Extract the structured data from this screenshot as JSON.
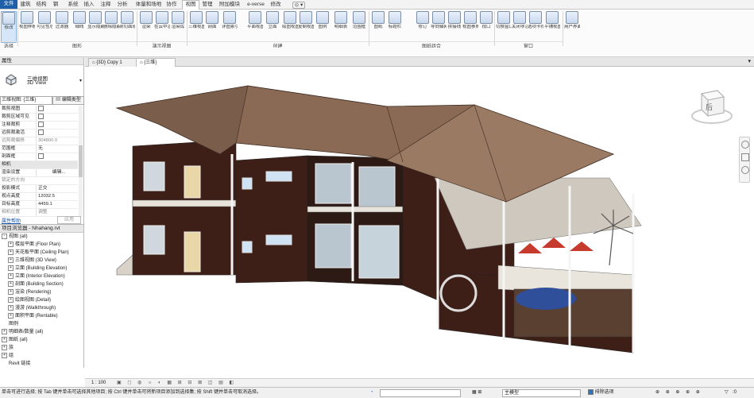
{
  "tabs": [
    "文件",
    "建筑",
    "结构",
    "钢",
    "系统",
    "插入",
    "注释",
    "分析",
    "体量和场地",
    "协作",
    "视图",
    "管理",
    "附加模块",
    "e-verse",
    "修改"
  ],
  "ribbon": {
    "buttons": [
      "修改",
      "视图样板",
      "可见性/图形",
      "过滤器",
      "细线",
      "显示隐藏线",
      "删除隐藏线",
      "剖切面轮廓",
      "渲染",
      "在云中渲染",
      "渲染库",
      "三维视图",
      "剖面",
      "详图索引",
      "平面视图",
      "立面",
      "绘图视图",
      "复制视图",
      "图例",
      "明细表",
      "范围框",
      "图纸",
      "标题栏",
      "修订",
      "导向轴网",
      "拼接线",
      "视图参照",
      "视口",
      "切换窗口",
      "关闭非活动",
      "选项卡视图",
      "平铺视图",
      "用户界面"
    ],
    "panels": [
      "选择",
      "图形",
      "演示视图",
      "创建",
      "图纸组合",
      "窗口"
    ]
  },
  "properties": {
    "title": "属性",
    "type_main": "三维视图",
    "type_sub": "3D View",
    "selector": "三维视图: {三维}",
    "edit_type": "编辑类型",
    "rows": [
      {
        "k": "裁剪视图",
        "v": ""
      },
      {
        "k": "裁剪区域可见",
        "v": ""
      },
      {
        "k": "注释裁剪",
        "v": ""
      },
      {
        "k": "远剪裁激活",
        "v": ""
      },
      {
        "k": "远剪裁偏移",
        "v": "304800.0"
      },
      {
        "k": "范围框",
        "v": "无"
      },
      {
        "k": "剖面框",
        "v": ""
      },
      {
        "k": "相机",
        "v": ""
      },
      {
        "k": "渲染设置",
        "v": "编辑..."
      },
      {
        "k": "锁定的方向",
        "v": ""
      },
      {
        "k": "投影模式",
        "v": "正交"
      },
      {
        "k": "视点高度",
        "v": "12032.5"
      },
      {
        "k": "目标高度",
        "v": "4459.1"
      },
      {
        "k": "相机位置",
        "v": "调整"
      }
    ],
    "help": "属性帮助",
    "apply": "应用"
  },
  "browser": {
    "title": "项目浏览器 - Nhahang.rvt",
    "items": [
      {
        "label": "视图 (all)",
        "level": 0,
        "sign": "-"
      },
      {
        "label": "楼层平面 (Floor Plan)",
        "level": 1,
        "sign": "+"
      },
      {
        "label": "天花板平面 (Ceiling Plan)",
        "level": 1,
        "sign": "+"
      },
      {
        "label": "三维视图 (3D View)",
        "level": 1,
        "sign": "+"
      },
      {
        "label": "立面 (Building Elevation)",
        "level": 1,
        "sign": "+"
      },
      {
        "label": "立面 (Interior Elevation)",
        "level": 1,
        "sign": "+"
      },
      {
        "label": "剖面 (Building Section)",
        "level": 1,
        "sign": "+"
      },
      {
        "label": "渲染 (Rendering)",
        "level": 1,
        "sign": "+"
      },
      {
        "label": "绘图视图 (Detail)",
        "level": 1,
        "sign": "+"
      },
      {
        "label": "漫游 (Walkthrough)",
        "level": 1,
        "sign": "+"
      },
      {
        "label": "面积平面 (Rentable)",
        "level": 1,
        "sign": "+"
      },
      {
        "label": "图例",
        "level": 0,
        "sign": ""
      },
      {
        "label": "明细表/数量 (all)",
        "level": 0,
        "sign": "+"
      },
      {
        "label": "图纸 (all)",
        "level": 0,
        "sign": "+"
      },
      {
        "label": "族",
        "level": 0,
        "sign": "+"
      },
      {
        "label": "组",
        "level": 0,
        "sign": "+"
      },
      {
        "label": "Revit 链接",
        "level": 0,
        "sign": ""
      }
    ]
  },
  "view_tabs": [
    "{3D} Copy 1",
    "{三维}"
  ],
  "viewcube_label": "后",
  "viewbar": {
    "scale": "1 : 100"
  },
  "status": {
    "hint": "单击可进行选择; 按 Tab 键并单击可选择其他项目; 按 Ctrl 键并单击可将新项目添加到选择集; 按 Shift 键并单击可取消选择。",
    "model": "主模型",
    "exclude": "排除选项",
    "count": ":0"
  },
  "colors": {
    "roof": "#8a6a55",
    "wall": "#3e1f17",
    "file_tab": "#1e5fa8",
    "accent": "#2d74c4"
  }
}
